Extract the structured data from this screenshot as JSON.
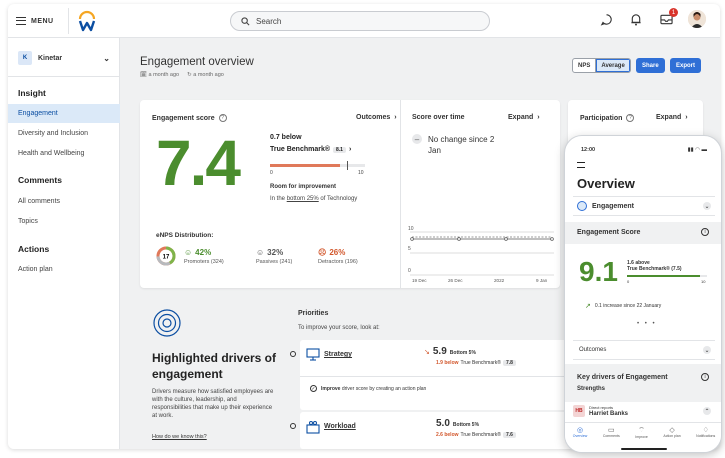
{
  "topbar": {
    "menu_label": "MENU",
    "search_placeholder": "Search",
    "notification_count": "1"
  },
  "sidebar": {
    "org_initial": "K",
    "org_name": "Kinetar",
    "sections": [
      {
        "title": "Insight",
        "items": [
          "Engagement",
          "Diversity and Inclusion",
          "Health and Wellbeing"
        ]
      },
      {
        "title": "Comments",
        "items": [
          "All comments",
          "Topics"
        ]
      },
      {
        "title": "Actions",
        "items": [
          "Action plan"
        ]
      }
    ],
    "active_item": "Engagement"
  },
  "page": {
    "title": "Engagement overview",
    "meta_created": "a month ago",
    "meta_updated": "a month ago",
    "toggle": [
      "NPS",
      "Average"
    ],
    "toggle_selected": "Average",
    "share_label": "Share",
    "export_label": "Export"
  },
  "engagement_card": {
    "title": "Engagement score",
    "outcomes_link": "Outcomes",
    "score": "7.4",
    "bench_line1": "0.7 below",
    "bench_line2": "True Benchmark®",
    "bench_value": "8.1",
    "bar_min": "0",
    "bar_max": "10",
    "bar_fraction": 0.74,
    "room_label": "Room for improvement",
    "room_text_pre": "In the",
    "room_text_link": "bottom 25%",
    "room_text_post": "of Technology",
    "enps_title": "eNPS Distribution:",
    "enps_score": "17",
    "promoters_pct": "42%",
    "promoters_label": "Promoters (324)",
    "passives_pct": "32%",
    "passives_label": "Passives (241)",
    "detractors_pct": "26%",
    "detractors_label": "Detractors (196)"
  },
  "score_time_card": {
    "title": "Score over time",
    "expand_label": "Expand",
    "no_change_line1": "No change since 2",
    "no_change_line2": "Jan",
    "y_ticks": [
      "10",
      "5",
      "0"
    ],
    "x_ticks": [
      "19 Dec",
      "26 Dec",
      "2022",
      "9 Jan"
    ]
  },
  "participation_card": {
    "title": "Participation",
    "expand_label": "Expand"
  },
  "drivers": {
    "title_line1": "Highlighted drivers of",
    "title_line2": "engagement",
    "desc": "Drivers measure how satisfied employees are with the culture, leadership, and responsibilities that make up their experience at work.",
    "link": "How do we know this?",
    "priorities_title": "Priorities",
    "priorities_sub": "To improve your score, look at:",
    "items": [
      {
        "name": "Strategy",
        "score": "5.9",
        "rank": "Bottom 5%",
        "delta": "1.9 below",
        "bench": "True Benchmark®",
        "bench_value": "7.8"
      },
      {
        "name": "Workload",
        "score": "5.0",
        "rank": "Bottom 5%",
        "delta": "2.6 below",
        "bench": "True Benchmark®",
        "bench_value": "7.6"
      }
    ],
    "improve_bold": "Improve",
    "improve_text": "driver score by creating an action plan"
  },
  "mobile": {
    "time": "12:00",
    "title": "Overview",
    "engagement_label": "Engagement",
    "score_header": "Engagement Score",
    "score": "9.1",
    "above_line1": "1.6 above",
    "above_line2": "True Benchmark® (7.5)",
    "bar_min": "0",
    "bar_max": "10",
    "bar_fraction": 0.91,
    "increase_text": "0.1 increase since 22 January",
    "outcomes_label": "Outcomes",
    "drivers_title": "Key drivers of Engagement",
    "strengths_label": "Strengths",
    "person_initials": "HB",
    "person_sub": "Direct reports",
    "person_name": "Harriet Banks",
    "tabs": [
      "Overview",
      "Comments",
      "Improve",
      "Action plan",
      "Notifications"
    ]
  },
  "colors": {
    "accent": "#2f6fd6",
    "score_green": "#4b8d2e",
    "bench_orange": "#e0795a",
    "active_bg": "#dbe9f8"
  }
}
